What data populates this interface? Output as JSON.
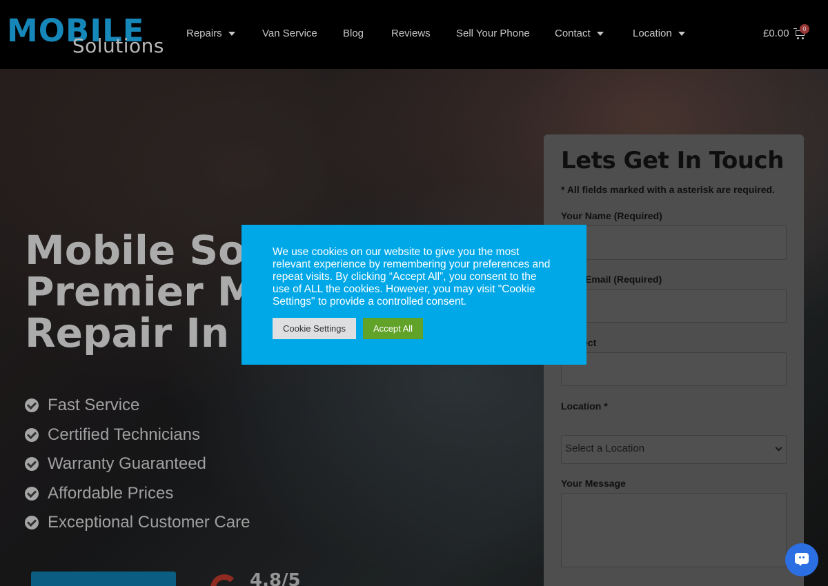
{
  "brand": {
    "word": "MOBILE",
    "sub": "Solutions"
  },
  "nav": {
    "items": [
      {
        "label": "Repairs",
        "dropdown": true
      },
      {
        "label": "Van Service",
        "dropdown": false
      },
      {
        "label": "Blog",
        "dropdown": false
      },
      {
        "label": "Reviews",
        "dropdown": false
      },
      {
        "label": "Sell Your Phone",
        "dropdown": false
      },
      {
        "label": "Contact",
        "dropdown": true
      },
      {
        "label": "Location",
        "dropdown": true
      }
    ],
    "cart_total": "£0.00",
    "cart_count": "0"
  },
  "hero": {
    "title_lines": [
      "Mobile Sol",
      "Premier Mo",
      "Repair In N"
    ],
    "features": [
      "Fast Service",
      "Certified Technicians",
      "Warranty Guaranteed",
      "Affordable Prices",
      "Exceptional Customer Care"
    ],
    "rating": "4.8/5"
  },
  "form": {
    "title": "Lets Get In Touch",
    "note": "* All fields marked with a asterisk are required.",
    "labels": {
      "name": "Your Name (Required)",
      "email": "Email (Required)",
      "subject": "ect",
      "location": "Location *",
      "message": "Your Message"
    },
    "location_placeholder": "Select a Location"
  },
  "cookie": {
    "text": "We use cookies on our website to give you the most relevant experience by remembering your preferences and repeat visits. By clicking “Accept All”, you consent to the use of ALL the cookies. However, you may visit \"Cookie Settings\" to provide a controlled consent.",
    "settings_label": "Cookie Settings",
    "accept_label": "Accept All",
    "background": "#00a8e8",
    "accept_color": "#61a229"
  },
  "colors": {
    "brand_blue": "#1a9fda",
    "chat_blue": "#2b6fe3"
  },
  "icons": {
    "cart": "shopping-cart-icon",
    "chat": "chat-icon",
    "check": "check-circle-icon"
  }
}
